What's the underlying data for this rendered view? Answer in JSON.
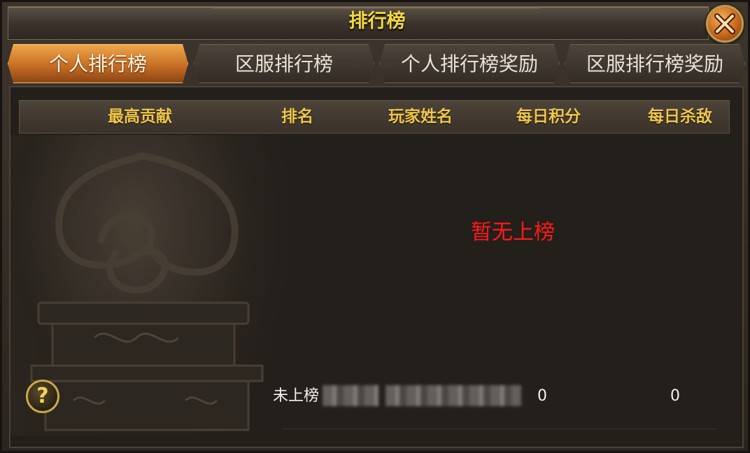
{
  "window": {
    "title": "排行榜"
  },
  "tabs": [
    {
      "label": "个人排行榜",
      "active": true
    },
    {
      "label": "区服排行榜",
      "active": false
    },
    {
      "label": "个人排行榜奖励",
      "active": false
    },
    {
      "label": "区服排行榜奖励",
      "active": false
    }
  ],
  "table": {
    "headers": [
      "最高贡献",
      "排名",
      "玩家姓名",
      "每日积分",
      "每日杀敌"
    ],
    "empty_message": "暂无上榜"
  },
  "self_row": {
    "rank": "未上榜",
    "daily_points": "0",
    "daily_kills": "0"
  },
  "help": {
    "label": "?"
  },
  "colors": {
    "title": "#f4d83a",
    "header_text": "#f0c64a",
    "empty_message": "#ff1a1a",
    "active_tab": "#e08a30"
  },
  "icons": {
    "close": "close-x-icon",
    "help": "question-mark-icon"
  }
}
